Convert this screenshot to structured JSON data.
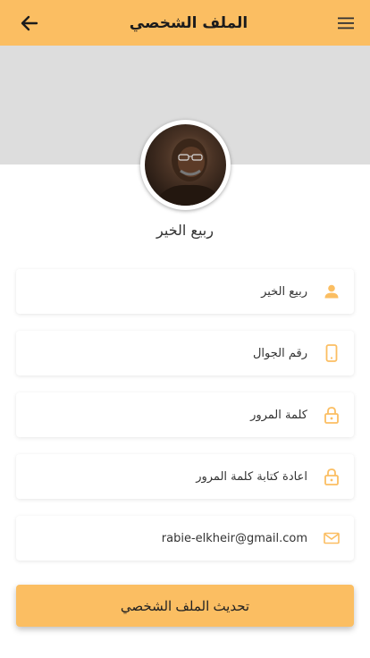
{
  "header": {
    "title": "الملف الشخصي"
  },
  "profile": {
    "name": "ربيع الخير"
  },
  "fields": [
    {
      "value": "ربيع الخير",
      "icon": "person-icon"
    },
    {
      "placeholder": "رقم الجوال",
      "icon": "phone-icon"
    },
    {
      "placeholder": "كلمة المرور",
      "icon": "lock-icon"
    },
    {
      "placeholder": "اعادة كتابة كلمة المرور",
      "icon": "lock-icon"
    },
    {
      "value": "rabie-elkheir@gmail.com",
      "icon": "mail-icon"
    }
  ],
  "actions": {
    "update_label": "تحديث الملف الشخصي"
  },
  "colors": {
    "accent": "#fbbe62",
    "cover": "#dddddd"
  }
}
